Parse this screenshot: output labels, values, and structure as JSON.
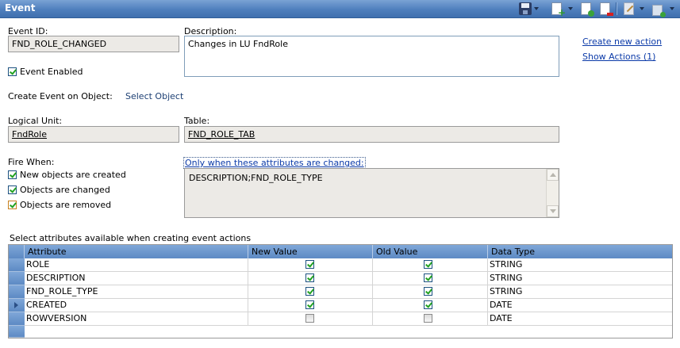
{
  "header": {
    "title": "Event"
  },
  "toolbar": {
    "icons": [
      "save-icon",
      "new-icon",
      "duplicate-icon",
      "delete-icon",
      "edit-icon",
      "actions-icon"
    ]
  },
  "form": {
    "event_id_label": "Event ID:",
    "event_id_value": "FND_ROLE_CHANGED",
    "description_label": "Description:",
    "description_value": "Changes in LU FndRole",
    "event_enabled_label": "Event Enabled",
    "event_enabled": true,
    "create_event_label": "Create Event on Object:",
    "select_object_link": "Select Object",
    "logical_unit_label": "Logical Unit:",
    "logical_unit_value": "FndRole",
    "table_label": "Table:",
    "table_value": "FND_ROLE_TAB",
    "fire_when_label": "Fire When:",
    "fire_when": [
      {
        "label": "New objects are created",
        "checked": true
      },
      {
        "label": "Objects are changed",
        "checked": true
      },
      {
        "label": "Objects are removed",
        "checked": true
      }
    ],
    "attributes_changed_link": "Only when these attributes are changed:",
    "attributes_changed_value": "DESCRIPTION;FND_ROLE_TYPE"
  },
  "actions": {
    "create_new_action": "Create new action",
    "show_actions": "Show Actions (1)"
  },
  "grid": {
    "caption": "Select attributes available when creating event actions",
    "columns": [
      "Attribute",
      "New Value",
      "Old Value",
      "Data Type"
    ],
    "rows": [
      {
        "attribute": "ROLE",
        "new_value": true,
        "old_value": true,
        "data_type": "STRING"
      },
      {
        "attribute": "DESCRIPTION",
        "new_value": true,
        "old_value": true,
        "data_type": "STRING"
      },
      {
        "attribute": "FND_ROLE_TYPE",
        "new_value": true,
        "old_value": true,
        "data_type": "STRING"
      },
      {
        "attribute": "CREATED",
        "new_value": true,
        "old_value": true,
        "data_type": "DATE"
      },
      {
        "attribute": "ROWVERSION",
        "new_value": false,
        "old_value": false,
        "data_type": "DATE"
      }
    ],
    "current_row": 3
  },
  "colors": {
    "header_blue": "#4f7fbd",
    "link_blue": "#0b3aa8",
    "check_green": "#21a121"
  }
}
